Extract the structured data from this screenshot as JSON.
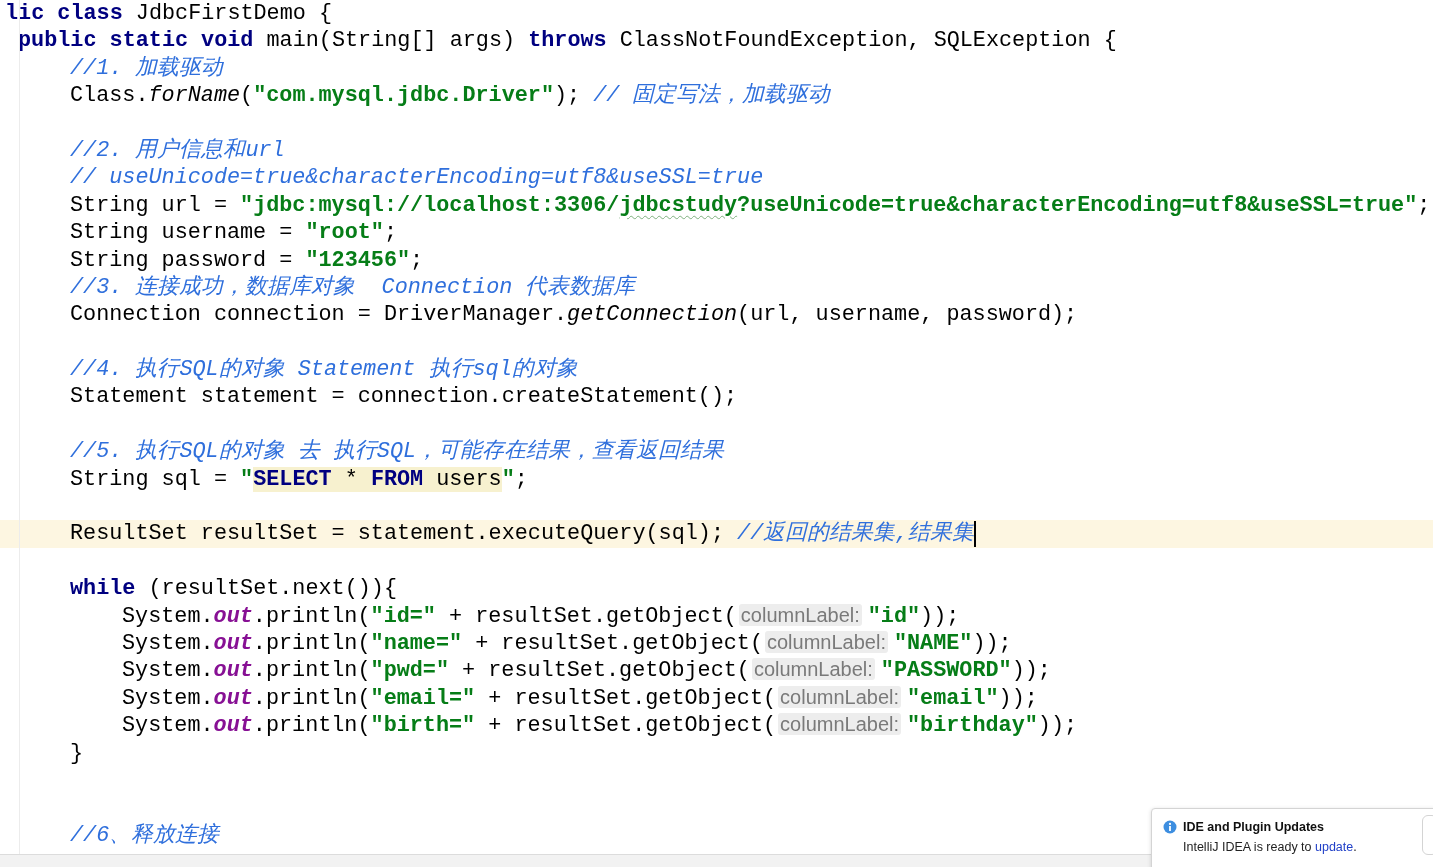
{
  "editor": {
    "lines": [
      {
        "current": false,
        "tokens": [
          {
            "text": "lic class",
            "kind": "keyword"
          },
          {
            "text": " JdbcFirstDemo {",
            "kind": "plain"
          }
        ],
        "children": [
          {
            "current": false,
            "tokens": [
              {
                "text": "public static void",
                "kind": "keyword"
              },
              {
                "text": " main(String[] args) ",
                "kind": "plain"
              },
              {
                "text": "throws",
                "kind": "keyword"
              },
              {
                "text": " ClassNotFoundException, SQLException {",
                "kind": "plain"
              }
            ],
            "children": [
              {
                "current": false,
                "tokens": [
                  {
                    "text": "//1. 加载驱动",
                    "kind": "comment"
                  }
                ]
              },
              {
                "current": false,
                "tokens": [
                  {
                    "text": "Class.",
                    "kind": "plain"
                  },
                  {
                    "text": "forName",
                    "kind": "method"
                  },
                  {
                    "text": "(",
                    "kind": "plain"
                  },
                  {
                    "text": "\"com.mysql.jdbc.Driver\"",
                    "kind": "string"
                  },
                  {
                    "text": "); ",
                    "kind": "plain"
                  },
                  {
                    "text": "// 固定写法，加载驱动",
                    "kind": "comment"
                  }
                ]
              },
              {
                "current": false
              },
              {
                "current": false,
                "tokens": [
                  {
                    "text": "//2. 用户信息和url",
                    "kind": "comment"
                  }
                ]
              },
              {
                "current": false,
                "tokens": [
                  {
                    "text": "// useUnicode=true&characterEncoding=utf8&useSSL=true",
                    "kind": "comment"
                  }
                ]
              },
              {
                "current": false,
                "tokens": [
                  {
                    "text": "String url = ",
                    "kind": "plain"
                  },
                  {
                    "text": "\"jdbc:mysql://localhost:3306/",
                    "kind": "string"
                  },
                  {
                    "text": "jdbcstudy",
                    "kind": "typo"
                  },
                  {
                    "text": "?useUnicode=true&characterEncoding=utf8&useSSL=true\"",
                    "kind": "string"
                  },
                  {
                    "text": ";",
                    "kind": "plain"
                  }
                ]
              },
              {
                "current": false,
                "tokens": [
                  {
                    "text": "String username = ",
                    "kind": "plain"
                  },
                  {
                    "text": "\"root\"",
                    "kind": "string"
                  },
                  {
                    "text": ";",
                    "kind": "plain"
                  }
                ]
              },
              {
                "current": false,
                "tokens": [
                  {
                    "text": "String password = ",
                    "kind": "plain"
                  },
                  {
                    "text": "\"123456\"",
                    "kind": "string"
                  },
                  {
                    "text": ";",
                    "kind": "plain"
                  }
                ]
              },
              {
                "current": false,
                "tokens": [
                  {
                    "text": "//3. 连接成功，数据库对象  Connection 代表数据库",
                    "kind": "comment"
                  }
                ]
              },
              {
                "current": false,
                "tokens": [
                  {
                    "text": "Connection connection = DriverManager.",
                    "kind": "plain"
                  },
                  {
                    "text": "getConnection",
                    "kind": "method"
                  },
                  {
                    "text": "(url, username, password);",
                    "kind": "plain"
                  }
                ]
              },
              {
                "current": false
              },
              {
                "current": false,
                "tokens": [
                  {
                    "text": "//4. 执行SQL的对象 Statement 执行sql的对象",
                    "kind": "comment"
                  }
                ]
              },
              {
                "current": false,
                "tokens": [
                  {
                    "text": "Statement statement = connection.createStatement();",
                    "kind": "plain"
                  }
                ]
              },
              {
                "current": false
              },
              {
                "current": false,
                "tokens": [
                  {
                    "text": "//5. 执行SQL的对象 去 执行SQL，可能存在结果，查看返回结果",
                    "kind": "comment"
                  }
                ]
              },
              {
                "current": false,
                "tokens": [
                  {
                    "text": "String sql = ",
                    "kind": "plain"
                  },
                  {
                    "text": "\"",
                    "kind": "string"
                  },
                  {
                    "text": "SELECT",
                    "kind": "sql_keyword"
                  },
                  {
                    "text": " * ",
                    "kind": "sql"
                  },
                  {
                    "text": "FROM",
                    "kind": "sql_keyword"
                  },
                  {
                    "text": " users",
                    "kind": "sql"
                  },
                  {
                    "text": "\"",
                    "kind": "string"
                  },
                  {
                    "text": ";",
                    "kind": "plain"
                  }
                ]
              },
              {
                "current": false
              },
              {
                "current": true,
                "tokens": [
                  {
                    "text": "ResultSet resultSet = statement.executeQuery(sql); ",
                    "kind": "plain"
                  },
                  {
                    "text": "//返回的结果集,结果集",
                    "kind": "comment"
                  }
                ]
              },
              {
                "current": false
              },
              {
                "current": false,
                "tokens": [
                  {
                    "text": "while",
                    "kind": "keyword"
                  },
                  {
                    "text": " (resultSet.next()){",
                    "kind": "plain"
                  }
                ],
                "children": [
                  {
                    "current": false,
                    "tokens": [
                      {
                        "text": "System.",
                        "kind": "plain"
                      },
                      {
                        "text": "out",
                        "kind": "field"
                      },
                      {
                        "text": ".println(",
                        "kind": "plain"
                      },
                      {
                        "text": "\"id=\"",
                        "kind": "string"
                      },
                      {
                        "text": " + resultSet.getObject(",
                        "kind": "plain"
                      },
                      {
                        "text": "columnLabel:",
                        "kind": "hint"
                      },
                      {
                        "text": "\"id\"",
                        "kind": "string"
                      },
                      {
                        "text": "));",
                        "kind": "plain"
                      }
                    ]
                  },
                  {
                    "current": false,
                    "tokens": [
                      {
                        "text": "System.",
                        "kind": "plain"
                      },
                      {
                        "text": "out",
                        "kind": "field"
                      },
                      {
                        "text": ".println(",
                        "kind": "plain"
                      },
                      {
                        "text": "\"name=\"",
                        "kind": "string"
                      },
                      {
                        "text": " + resultSet.getObject(",
                        "kind": "plain"
                      },
                      {
                        "text": "columnLabel:",
                        "kind": "hint"
                      },
                      {
                        "text": "\"NAME\"",
                        "kind": "string"
                      },
                      {
                        "text": "));",
                        "kind": "plain"
                      }
                    ]
                  },
                  {
                    "current": false,
                    "tokens": [
                      {
                        "text": "System.",
                        "kind": "plain"
                      },
                      {
                        "text": "out",
                        "kind": "field"
                      },
                      {
                        "text": ".println(",
                        "kind": "plain"
                      },
                      {
                        "text": "\"pwd=\"",
                        "kind": "string"
                      },
                      {
                        "text": " + resultSet.getObject(",
                        "kind": "plain"
                      },
                      {
                        "text": "columnLabel:",
                        "kind": "hint"
                      },
                      {
                        "text": "\"PASSWORD\"",
                        "kind": "string"
                      },
                      {
                        "text": "));",
                        "kind": "plain"
                      }
                    ]
                  },
                  {
                    "current": false,
                    "tokens": [
                      {
                        "text": "System.",
                        "kind": "plain"
                      },
                      {
                        "text": "out",
                        "kind": "field"
                      },
                      {
                        "text": ".println(",
                        "kind": "plain"
                      },
                      {
                        "text": "\"email=\"",
                        "kind": "string"
                      },
                      {
                        "text": " + resultSet.getObject(",
                        "kind": "plain"
                      },
                      {
                        "text": "columnLabel:",
                        "kind": "hint"
                      },
                      {
                        "text": "\"email\"",
                        "kind": "string"
                      },
                      {
                        "text": "));",
                        "kind": "plain"
                      }
                    ]
                  },
                  {
                    "current": false,
                    "tokens": [
                      {
                        "text": "System.",
                        "kind": "plain"
                      },
                      {
                        "text": "out",
                        "kind": "field"
                      },
                      {
                        "text": ".println(",
                        "kind": "plain"
                      },
                      {
                        "text": "\"birth=\"",
                        "kind": "string"
                      },
                      {
                        "text": " + resultSet.getObject(",
                        "kind": "plain"
                      },
                      {
                        "text": "columnLabel:",
                        "kind": "hint"
                      },
                      {
                        "text": "\"birthday\"",
                        "kind": "string"
                      },
                      {
                        "text": "));",
                        "kind": "plain"
                      }
                    ]
                  }
                ]
              },
              {
                "current": false,
                "tokens": [
                  {
                    "text": "}",
                    "kind": "plain"
                  }
                ]
              },
              {
                "current": false
              },
              {
                "current": false
              },
              {
                "current": false,
                "tokens": [
                  {
                    "text": "//6、释放连接",
                    "kind": "comment"
                  }
                ]
              }
            ]
          }
        ]
      }
    ]
  },
  "notification": {
    "title": "IDE and Plugin Updates",
    "message": "IntelliJ IDEA is ready to ",
    "link": "update",
    "message_end": "."
  }
}
